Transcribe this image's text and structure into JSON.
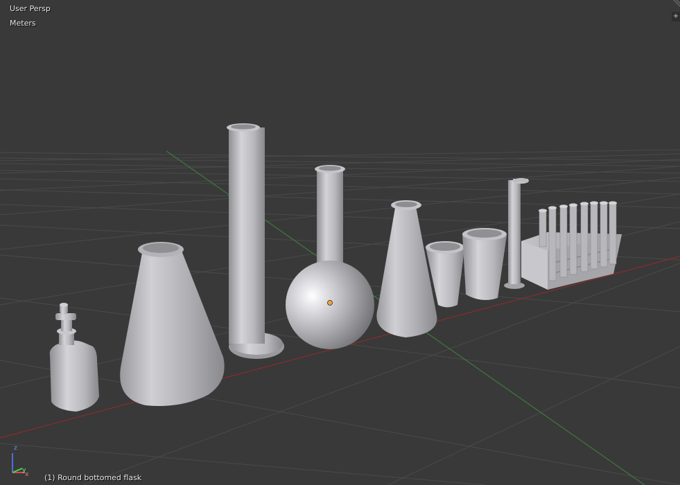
{
  "viewport": {
    "view_name": "User Persp",
    "units": "Meters",
    "selected_object": "(1) Round bottomed flask"
  },
  "gizmo": {
    "z_label": "z",
    "y_label": "y",
    "x_label": "x"
  },
  "corner_button_icon": "plus-icon",
  "colors": {
    "background": "#393939",
    "grid": "#4a4a4a",
    "x_axis": "#8a2c2c",
    "y_axis": "#3d7a3d",
    "model_gray": "#b4b4b8",
    "text": "#e8e8e8"
  }
}
